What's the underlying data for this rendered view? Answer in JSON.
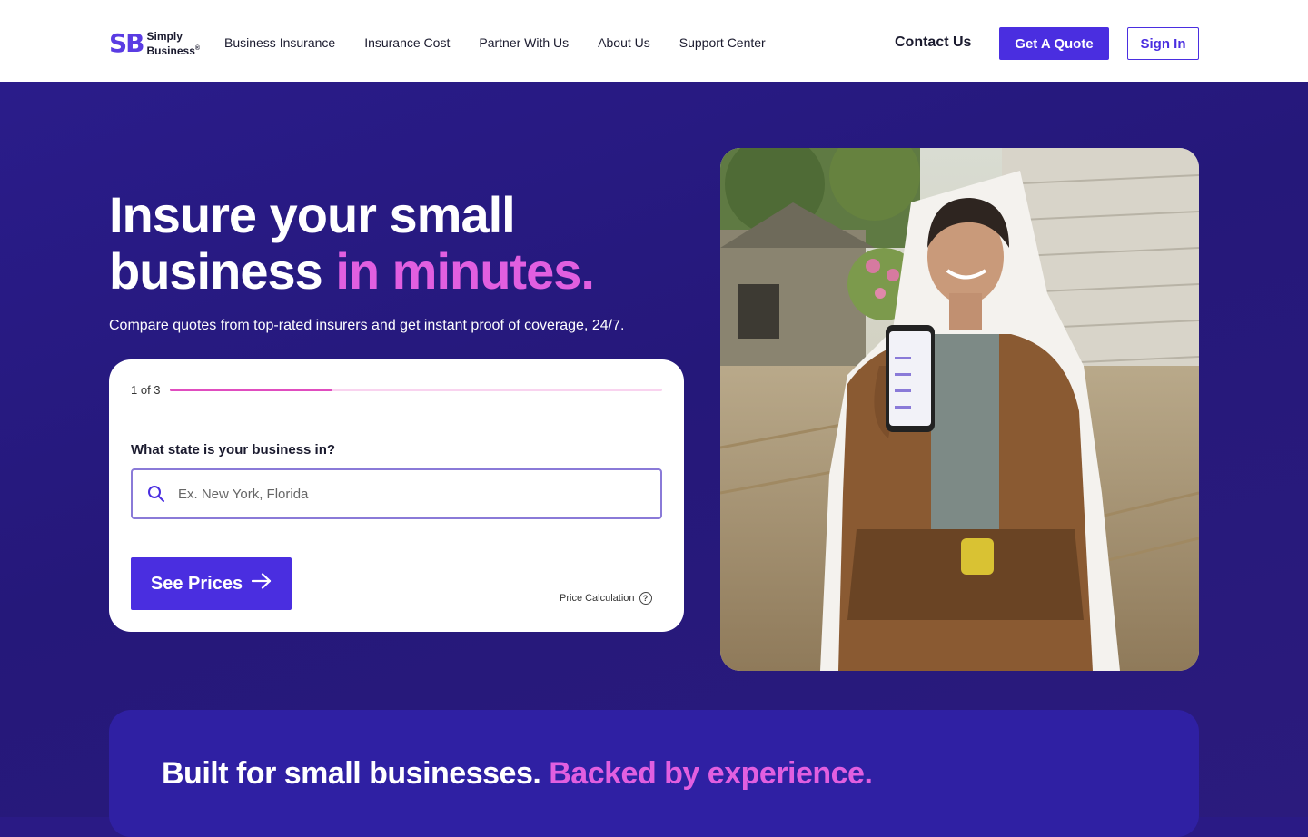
{
  "brand": {
    "mark": "SB",
    "line1": "Simply",
    "line2": "Business",
    "reg": "®"
  },
  "nav": [
    {
      "label": "Business Insurance"
    },
    {
      "label": "Insurance Cost"
    },
    {
      "label": "Partner With Us"
    },
    {
      "label": "About Us"
    },
    {
      "label": "Support Center"
    }
  ],
  "header": {
    "contact_label": "Contact Us",
    "quote_label": "Get A Quote",
    "signin_label": "Sign In"
  },
  "hero": {
    "title_line1": "Insure your small",
    "title_line2_plain": "business ",
    "title_line2_accent": "in minutes.",
    "subtitle": "Compare quotes from top-rated insurers and get instant proof of coverage, 24/7."
  },
  "form": {
    "step_text": "1 of 3",
    "progress": 0.33,
    "question": "What state is your business in?",
    "search_placeholder": "Ex. New York, Florida",
    "submit_label": "See Prices",
    "price_calc_label": "Price Calculation"
  },
  "band": {
    "title_plain": "Built for small businesses. ",
    "title_accent": "Backed by experience."
  },
  "colors": {
    "primary": "#4a2ee0",
    "accent": "#e15fe0",
    "hero_bg": "#2a1c8a"
  }
}
